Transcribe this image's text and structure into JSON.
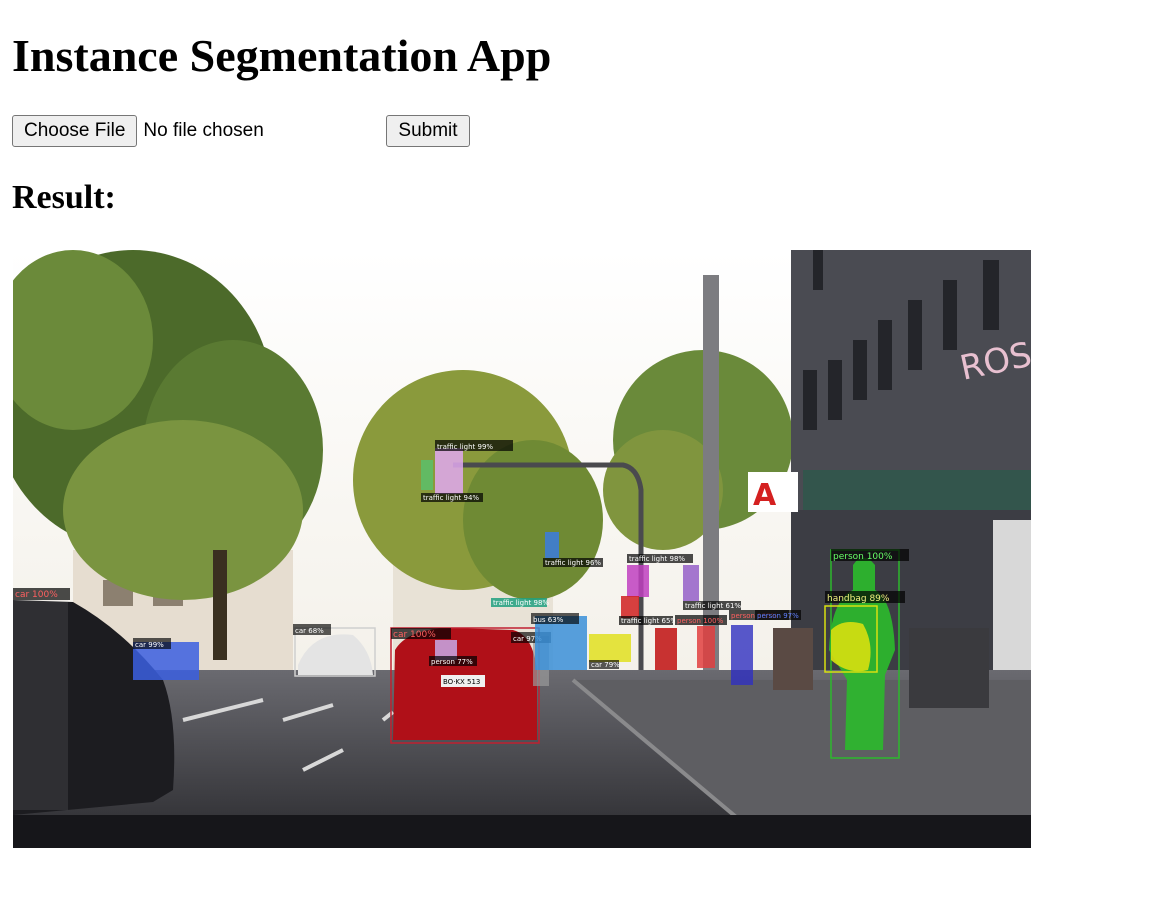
{
  "page": {
    "title": "Instance Segmentation App",
    "result_heading": "Result:"
  },
  "upload_form": {
    "choose_file_label": "Choose File",
    "file_status": "No file chosen",
    "submit_label": "Submit"
  },
  "result": {
    "image_description": "Street scene with instance segmentation overlays",
    "sign_text": "ROSSM",
    "plate_text": "BO·KX 513",
    "detections": [
      {
        "label": "car 100%",
        "color": "#c0c0c0"
      },
      {
        "label": "car 99%",
        "color": "#3b5fe0"
      },
      {
        "label": "car 68%",
        "color": "#d9d9d9"
      },
      {
        "label": "car 100%",
        "color": "#b01018"
      },
      {
        "label": "car 97%",
        "color": "#9a9a9a"
      },
      {
        "label": "person 77%",
        "color": "#c8a8e8"
      },
      {
        "label": "bus 63%",
        "color": "#3a8fd8"
      },
      {
        "label": "car 79%",
        "color": "#e0e020"
      },
      {
        "label": "traffic light 99%",
        "color": "#e0a8f0"
      },
      {
        "label": "traffic light 94%",
        "color": "#5bbf6a"
      },
      {
        "label": "traffic light 96%",
        "color": "#3b7be0"
      },
      {
        "label": "traffic light 98%",
        "color": "#c040c0"
      },
      {
        "label": "traffic light 99%",
        "color": "#8040c0"
      },
      {
        "label": "traffic light 98%",
        "color": "#20a080"
      },
      {
        "label": "traffic light 65%",
        "color": "#d02020"
      },
      {
        "label": "traffic light 61%",
        "color": "#4040d0"
      },
      {
        "label": "person 100%",
        "color": "#c01010"
      },
      {
        "label": "person 100%",
        "color": "#e04040"
      },
      {
        "label": "person 97%",
        "color": "#3030c0"
      },
      {
        "label": "person 100%",
        "color": "#2db82d"
      },
      {
        "label": "handbag 89%",
        "color": "#d8e010"
      }
    ]
  }
}
